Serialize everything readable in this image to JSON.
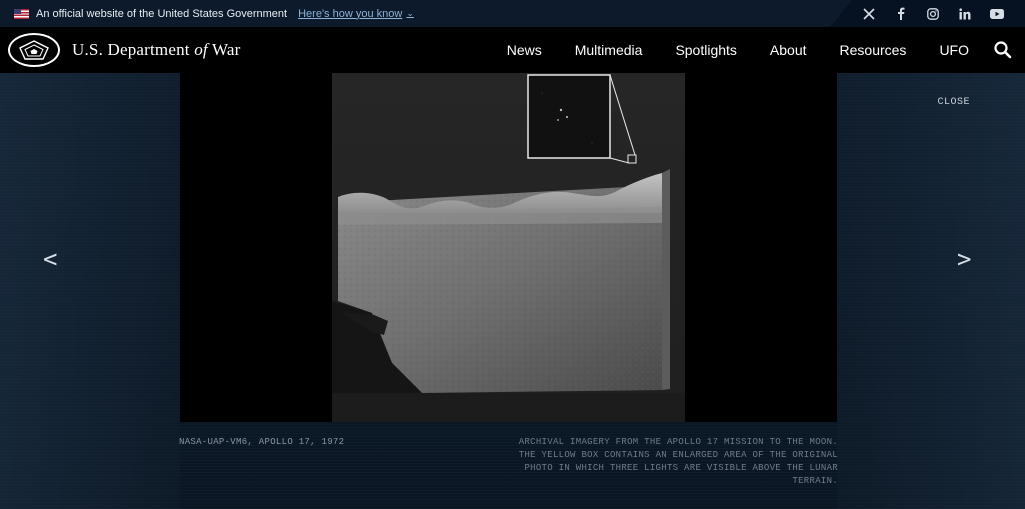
{
  "gov_banner": {
    "text": "An official website of the United States Government",
    "link_text": "Here's how you know"
  },
  "social": {
    "icons": [
      "x-icon",
      "facebook-icon",
      "instagram-icon",
      "linkedin-icon",
      "youtube-icon"
    ]
  },
  "header": {
    "title_prefix": "U.S. Department ",
    "title_of": "of",
    "title_suffix": " War"
  },
  "nav": {
    "items": [
      "News",
      "Multimedia",
      "Spotlights",
      "About",
      "Resources",
      "UFO"
    ]
  },
  "lightbox": {
    "close_label": "CLOSE",
    "prev_label": "<",
    "next_label": ">",
    "caption_id": "NASA-UAP-VM6, APOLLO 17, 1972",
    "caption_desc": "ARCHIVAL IMAGERY FROM THE APOLLO 17 MISSION TO THE MOON. THE YELLOW BOX CONTAINS AN ENLARGED AREA OF THE ORIGINAL PHOTO IN WHICH THREE LIGHTS ARE VISIBLE ABOVE THE LUNAR TERRAIN."
  },
  "colors": {
    "banner_bg": "#0c1a2b",
    "header_bg": "#000000",
    "link": "#8fb3d9"
  }
}
